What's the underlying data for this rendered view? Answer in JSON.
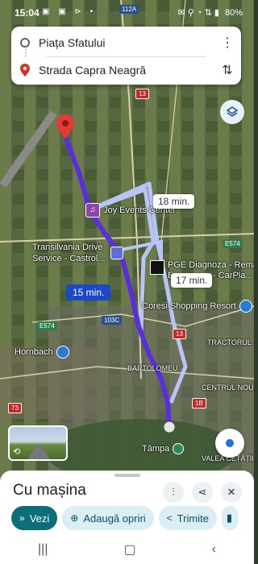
{
  "status": {
    "time": "15:04",
    "battery": "80%",
    "left_icons": "▣ ▣ ⊳ •",
    "right_icons": "✉ ⚲ ◔ ⇅ ▮"
  },
  "route": {
    "origin": "Piața Sfatului",
    "destination": "Strada Capra Neagră",
    "more_icon": "more-vert-icon",
    "swap_icon": "swap-icon"
  },
  "map": {
    "primary_time": "15 min.",
    "alt_times": [
      "18 min.",
      "17 min."
    ],
    "places": {
      "joy": "Joy Events Center",
      "transilvania": "Transilvania Drive\nService - Castrol...",
      "pge": "PGE Diagnoza - Rema\nE...",
      "pge_tail": "- CarPla...",
      "coresi": "Coresi Shopping Resort",
      "hornbach": "Hornbach",
      "tampa": "Tâmpa",
      "bartolomeu": "BARTOLOMEU",
      "tractorul": "TRACTORUL",
      "centrul_nou": "CENTRUL NOU",
      "valea": "VALEA CETĂȚII"
    },
    "roads": {
      "r112a": "112A",
      "r13a": "13",
      "r13b": "13",
      "e574a": "E574",
      "e574b": "E574",
      "r103c": "103C",
      "r73": "73",
      "r1b": "1B"
    }
  },
  "sheet": {
    "title": "Cu mașina",
    "actions": [
      {
        "label": "Vezi",
        "icon": "»"
      },
      {
        "label": "Adaugă opriri",
        "icon": "⊕"
      },
      {
        "label": "Trimite",
        "icon": "<"
      }
    ]
  },
  "colors": {
    "route": "#5a2ee0",
    "route_alt": "#b8c4f6",
    "accent": "#0b6e78"
  }
}
